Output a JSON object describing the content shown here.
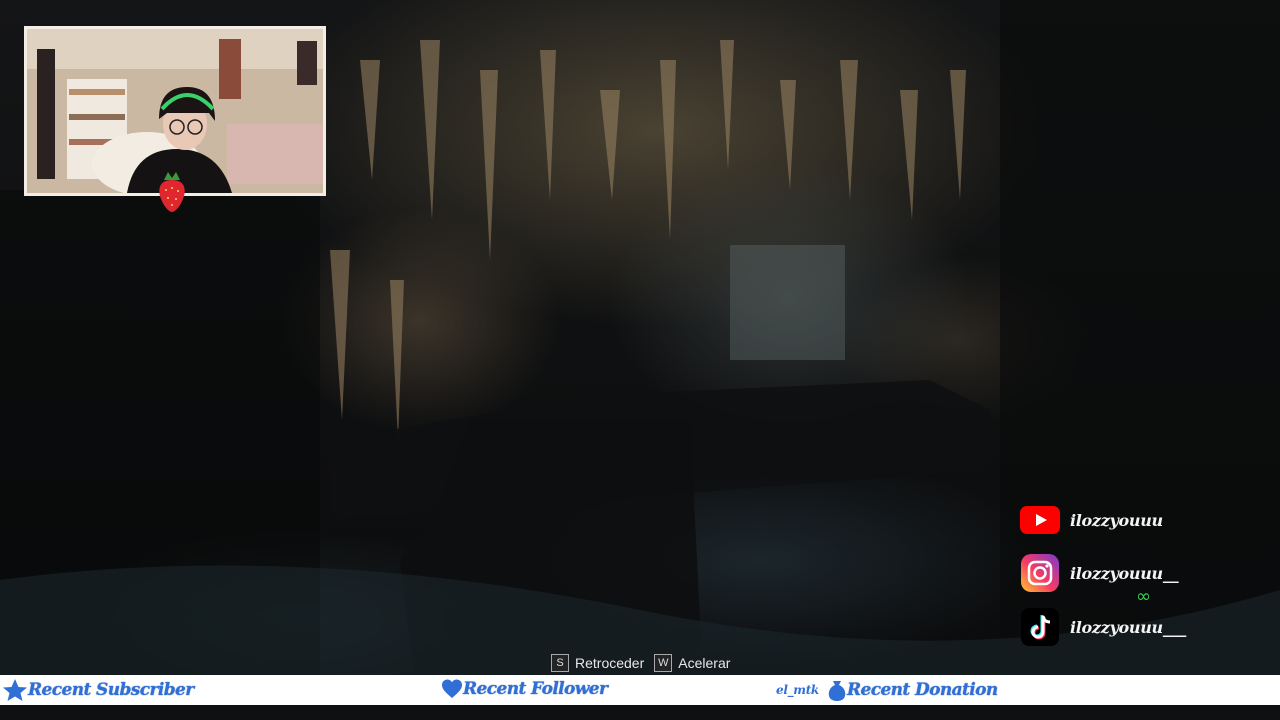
{
  "overlay": {
    "socials": [
      {
        "platform_icon": "youtube-icon",
        "handle": "ilozzyouuu"
      },
      {
        "platform_icon": "instagram-icon",
        "handle": "ilozzyouuu__"
      },
      {
        "platform_icon": "tiktok-icon",
        "handle": "ilozzyouuu___"
      }
    ],
    "infinity_glyph": "∞",
    "bottom_bar": {
      "recent_subscriber_label": "Recent Subscriber",
      "recent_follower_label": "Recent Follower",
      "recent_donation_value": "el_mtk",
      "recent_donation_label": "Recent Donation"
    }
  },
  "game": {
    "controls": [
      {
        "key": "S",
        "label": "Retroceder"
      },
      {
        "key": "W",
        "label": "Acelerar"
      }
    ]
  },
  "colors": {
    "accent_blue": "#2f6fd6",
    "youtube_red": "#ff0000",
    "tiktok_cyan": "#25f4ee",
    "tiktok_pink": "#fe2c55",
    "infinity_green": "#3bd05a"
  }
}
